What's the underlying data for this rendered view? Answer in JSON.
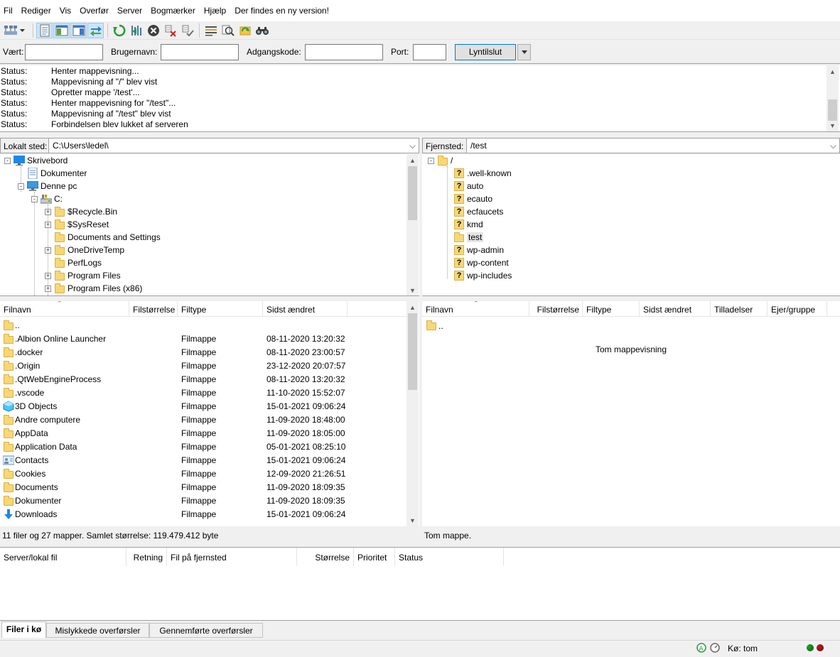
{
  "menu": [
    "Fil",
    "Rediger",
    "Vis",
    "Overfør",
    "Server",
    "Bogmærker",
    "Hjælp",
    "Der findes en ny version!"
  ],
  "toolbar": {
    "icons": [
      "site-manager-icon",
      "site-manager-dropdown-icon",
      "toggle-message-log-icon",
      "toggle-local-tree-icon",
      "toggle-remote-tree-icon",
      "toggle-transfer-queue-icon",
      "refresh-icon",
      "process-queue-icon",
      "cancel-icon",
      "disconnect-icon",
      "reconnect-icon",
      "directory-filter-icon",
      "toggle-comparison-icon",
      "sync-browsing-icon",
      "search-remote-icon"
    ]
  },
  "quickconnect": {
    "host_label": "Vært:",
    "host_value": "",
    "user_label": "Brugernavn:",
    "user_value": "",
    "pass_label": "Adgangskode:",
    "pass_value": "",
    "port_label": "Port:",
    "port_value": "",
    "button": "Lyntilslut"
  },
  "log": [
    {
      "type": "Status:",
      "msg": "Henter mappevisning..."
    },
    {
      "type": "Status:",
      "msg": "Mappevisning af \"/\" blev vist"
    },
    {
      "type": "Status:",
      "msg": "Opretter mappe '/test'..."
    },
    {
      "type": "Status:",
      "msg": "Henter mappevisning for \"/test\"..."
    },
    {
      "type": "Status:",
      "msg": "Mappevisning af \"/test\" blev vist"
    },
    {
      "type": "Status:",
      "msg": "Forbindelsen blev lukket af serveren"
    }
  ],
  "local": {
    "label": "Lokalt sted:",
    "path": "C:\\Users\\ledel\\",
    "tree": [
      {
        "name": "Skrivebord",
        "icon": "desktop-icon",
        "exp": "-"
      },
      {
        "name": "Dokumenter",
        "icon": "documents-icon",
        "exp": ""
      },
      {
        "name": "Denne pc",
        "icon": "computer-icon",
        "exp": "-"
      },
      {
        "name": "C:",
        "icon": "drive-icon",
        "exp": "-"
      },
      {
        "name": "$Recycle.Bin",
        "icon": "folder-icon",
        "exp": "+"
      },
      {
        "name": "$SysReset",
        "icon": "folder-icon",
        "exp": "+"
      },
      {
        "name": "Documents and Settings",
        "icon": "folder-icon",
        "exp": ""
      },
      {
        "name": "OneDriveTemp",
        "icon": "folder-icon",
        "exp": "+"
      },
      {
        "name": "PerfLogs",
        "icon": "folder-icon",
        "exp": ""
      },
      {
        "name": "Program Files",
        "icon": "folder-icon",
        "exp": "+"
      },
      {
        "name": "Program Files (x86)",
        "icon": "folder-icon",
        "exp": "+"
      }
    ],
    "columns": [
      "Filnavn",
      "Filstørrelse",
      "Filtype",
      "Sidst ændret"
    ],
    "files": [
      {
        "name": "..",
        "type": "",
        "modified": "",
        "icon": "folder-icon"
      },
      {
        "name": ".Albion Online Launcher",
        "type": "Filmappe",
        "modified": "08-11-2020 13:20:32",
        "icon": "folder-icon"
      },
      {
        "name": ".docker",
        "type": "Filmappe",
        "modified": "08-11-2020 23:00:57",
        "icon": "folder-icon"
      },
      {
        "name": ".Origin",
        "type": "Filmappe",
        "modified": "23-12-2020 20:07:57",
        "icon": "folder-icon"
      },
      {
        "name": ".QtWebEngineProcess",
        "type": "Filmappe",
        "modified": "08-11-2020 13:20:32",
        "icon": "folder-icon"
      },
      {
        "name": ".vscode",
        "type": "Filmappe",
        "modified": "11-10-2020 15:52:07",
        "icon": "folder-icon"
      },
      {
        "name": "3D Objects",
        "type": "Filmappe",
        "modified": "15-01-2021 09:06:24",
        "icon": "3d-objects-icon"
      },
      {
        "name": "Andre computere",
        "type": "Filmappe",
        "modified": "11-09-2020 18:48:00",
        "icon": "folder-icon"
      },
      {
        "name": "AppData",
        "type": "Filmappe",
        "modified": "11-09-2020 18:05:00",
        "icon": "folder-icon"
      },
      {
        "name": "Application Data",
        "type": "Filmappe",
        "modified": "05-01-2021 08:25:10",
        "icon": "folder-icon"
      },
      {
        "name": "Contacts",
        "type": "Filmappe",
        "modified": "15-01-2021 09:06:24",
        "icon": "contacts-icon"
      },
      {
        "name": "Cookies",
        "type": "Filmappe",
        "modified": "12-09-2020 21:26:51",
        "icon": "folder-icon"
      },
      {
        "name": "Documents",
        "type": "Filmappe",
        "modified": "11-09-2020 18:09:35",
        "icon": "folder-icon"
      },
      {
        "name": "Dokumenter",
        "type": "Filmappe",
        "modified": "11-09-2020 18:09:35",
        "icon": "folder-icon"
      },
      {
        "name": "Downloads",
        "type": "Filmappe",
        "modified": "15-01-2021 09:06:24",
        "icon": "downloads-icon"
      }
    ],
    "status": "11 filer og 27 mapper. Samlet størrelse: 119.479.412 byte"
  },
  "remote": {
    "label": "Fjernsted:",
    "path": "/test",
    "tree": [
      {
        "name": "/",
        "icon": "folder-icon",
        "exp": "-"
      },
      {
        "name": ".well-known",
        "icon": "unknown-folder-icon",
        "exp": ""
      },
      {
        "name": "auto",
        "icon": "unknown-folder-icon",
        "exp": ""
      },
      {
        "name": "ecauto",
        "icon": "unknown-folder-icon",
        "exp": ""
      },
      {
        "name": "ecfaucets",
        "icon": "unknown-folder-icon",
        "exp": ""
      },
      {
        "name": "kmd",
        "icon": "unknown-folder-icon",
        "exp": ""
      },
      {
        "name": "test",
        "icon": "folder-icon",
        "exp": "",
        "selected": true
      },
      {
        "name": "wp-admin",
        "icon": "unknown-folder-icon",
        "exp": ""
      },
      {
        "name": "wp-content",
        "icon": "unknown-folder-icon",
        "exp": ""
      },
      {
        "name": "wp-includes",
        "icon": "unknown-folder-icon",
        "exp": ""
      }
    ],
    "columns": [
      "Filnavn",
      "Filstørrelse",
      "Filtype",
      "Sidst ændret",
      "Tilladelser",
      "Ejer/gruppe"
    ],
    "files": [
      {
        "name": "..",
        "icon": "folder-icon"
      }
    ],
    "empty_text": "Tom mappevisning",
    "status": "Tom mappe."
  },
  "queue": {
    "columns": [
      "Server/lokal fil",
      "Retning",
      "Fil på fjernsted",
      "Størrelse",
      "Prioritet",
      "Status"
    ]
  },
  "tabs": [
    "Filer i kø",
    "Mislykkede overførsler",
    "Gennemførte overførsler"
  ],
  "statusbar": {
    "queue": "Kø: tom"
  },
  "colors": {
    "accent": "#0078d7",
    "folder": "#f8d775",
    "led_green": "#1a9a1a",
    "led_red": "#b01a1a"
  }
}
